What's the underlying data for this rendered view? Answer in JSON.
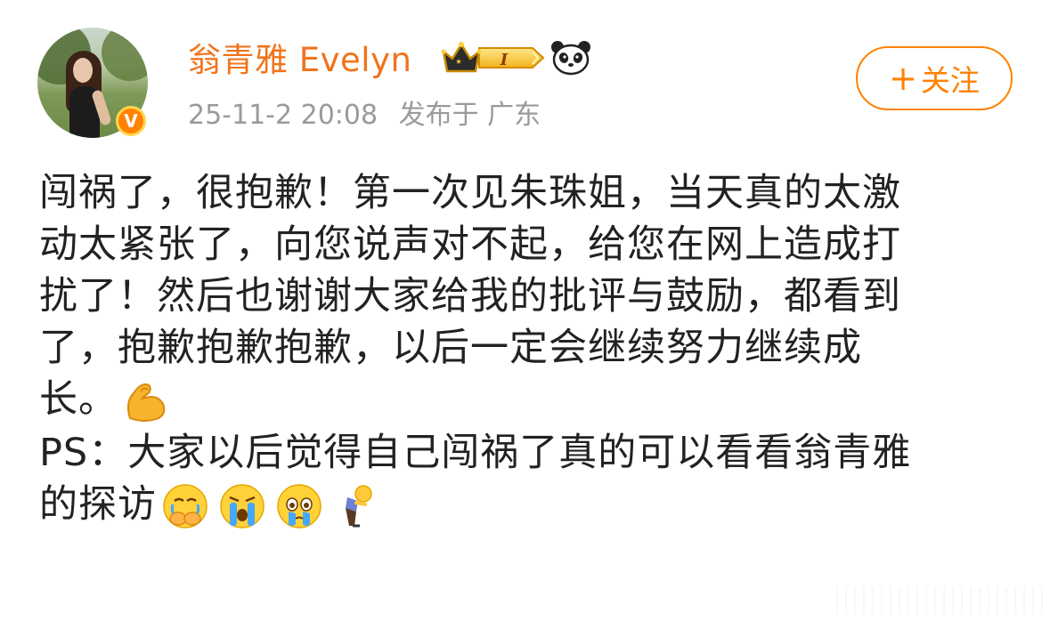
{
  "user": {
    "name": "翁青雅 Evelyn",
    "verified_mark": "V",
    "level_badge": "I",
    "timestamp": "25-11-2 20:08",
    "location": "发布于 广东"
  },
  "follow": {
    "plus": "+",
    "label": "关注"
  },
  "post": {
    "lines": [
      "闯祸了，很抱歉！第一次见朱珠姐，当天真的太激",
      "动太紧张了，向您说声对不起，给您在网上造成打",
      "扰了！然后也谢谢大家给我的批评与鼓励，都看到",
      "了，抱歉抱歉抱歉，以后一定会继续努力继续成",
      "长。",
      "PS：大家以后觉得自己闯祸了真的可以看看翁青雅",
      "的探访"
    ],
    "emojis": [
      "flexed-biceps-icon",
      "hands-over-mouth-crying-icon",
      "loudly-crying-icon",
      "teary-eyed-icon",
      "bowing-person-icon"
    ]
  },
  "colors": {
    "accent": "#ff8200",
    "username": "#f0741b",
    "meta": "#9a9a9a",
    "text": "#222222"
  }
}
